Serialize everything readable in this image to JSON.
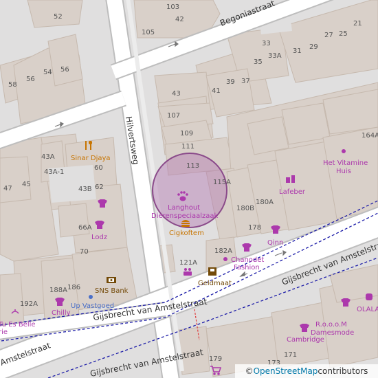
{
  "colors": {
    "building": "#d9d0c9",
    "building_stroke": "#c6b9ae",
    "road": "#ffffff",
    "road_casing": "#bdbdbd",
    "residential_area": "#e0dfdf",
    "shop_purple": "#ac39ac",
    "food_orange": "#c77400",
    "circle_fill": "#b47bb4",
    "circle_stroke": "#8a4a8a",
    "path_blue": "#1c1ca8",
    "path_red": "#e04040"
  },
  "streets": {
    "hilvertsweg": "Hilvertsweg",
    "begoniastraat": "Begoniastraat",
    "gijsbrecht_right": "Gijsbrecht van Amstelstraat",
    "gijsbrecht_mid": "Gijsbrecht van Amstelstraat",
    "gijsbrecht_bottom": "Gijsbrecht van Amstelstraat",
    "amstelstraat": "Amstelstraat"
  },
  "house_numbers": {
    "n52": "52",
    "n103": "103",
    "n42": "42",
    "n105": "105",
    "n33": "33",
    "n33a": "33A",
    "n35": "35",
    "n31": "31",
    "n29": "29",
    "n25": "25",
    "n27": "27",
    "n21": "21",
    "n58": "58",
    "n56l": "56",
    "n54": "54",
    "n56": "56",
    "n43": "43",
    "n41": "41",
    "n39": "39",
    "n37": "37",
    "n107": "107",
    "n109": "109",
    "n111": "111",
    "n113": "113",
    "n115a": "115A",
    "n43a": "43A",
    "n43a1": "43A-1",
    "n60": "60",
    "n43b": "43B",
    "n62": "62",
    "n47": "47",
    "n45": "45",
    "n66a": "66A",
    "n70": "70",
    "n180b": "180B",
    "n180a": "180A",
    "n178": "178",
    "n182a": "182A",
    "n121a": "121A",
    "n188a": "188A",
    "n186": "186",
    "n192a": "192A",
    "n164a": "164A",
    "n179": "179",
    "n173": "173",
    "n171": "171"
  },
  "pois": {
    "sinar_djaya": "Sinar Djaya",
    "lodz": "Lodz",
    "sns_bank": "SNS Bank",
    "up_vastgoed": "Up Vastgoed",
    "chilly": "Chilly",
    "tu_es_belle_l1": "Tu Es Belle",
    "tu_es_belle_l2": "rie",
    "langhout_l1": "Langhout",
    "langhout_l2": "Dierenspeciaalzaak",
    "cigkoftem": "Cigkoftem",
    "geldmaat": "Geldmaat",
    "chanodet_l1": "Chanodet",
    "chanodet_l2": "Fashion",
    "qinn": "Qinn",
    "lafeber": "Lafeber",
    "het_vitamine_l1": "Het Vitamine",
    "het_vitamine_l2": "Huis",
    "olala": "OLALA",
    "rooom_l1": "R.o.o.o.M",
    "rooom_l2": "Damesmode",
    "cambridge": "Cambridge"
  },
  "icons": {
    "clothes": "clothes-icon",
    "restaurant": "restaurant-icon",
    "pet": "paw-icon",
    "atm": "atm-icon",
    "bank": "bank-icon",
    "fast_food": "burger-icon",
    "shop": "shop-dot-icon",
    "gift": "gift-icon",
    "confectionery": "cake-icon",
    "beauty": "beauty-icon",
    "cart": "cart-icon",
    "arrow": "oneway-arrow-icon"
  },
  "attribution": {
    "copyright": "© ",
    "link": "OpenStreetMap",
    "suffix": " contributors"
  }
}
